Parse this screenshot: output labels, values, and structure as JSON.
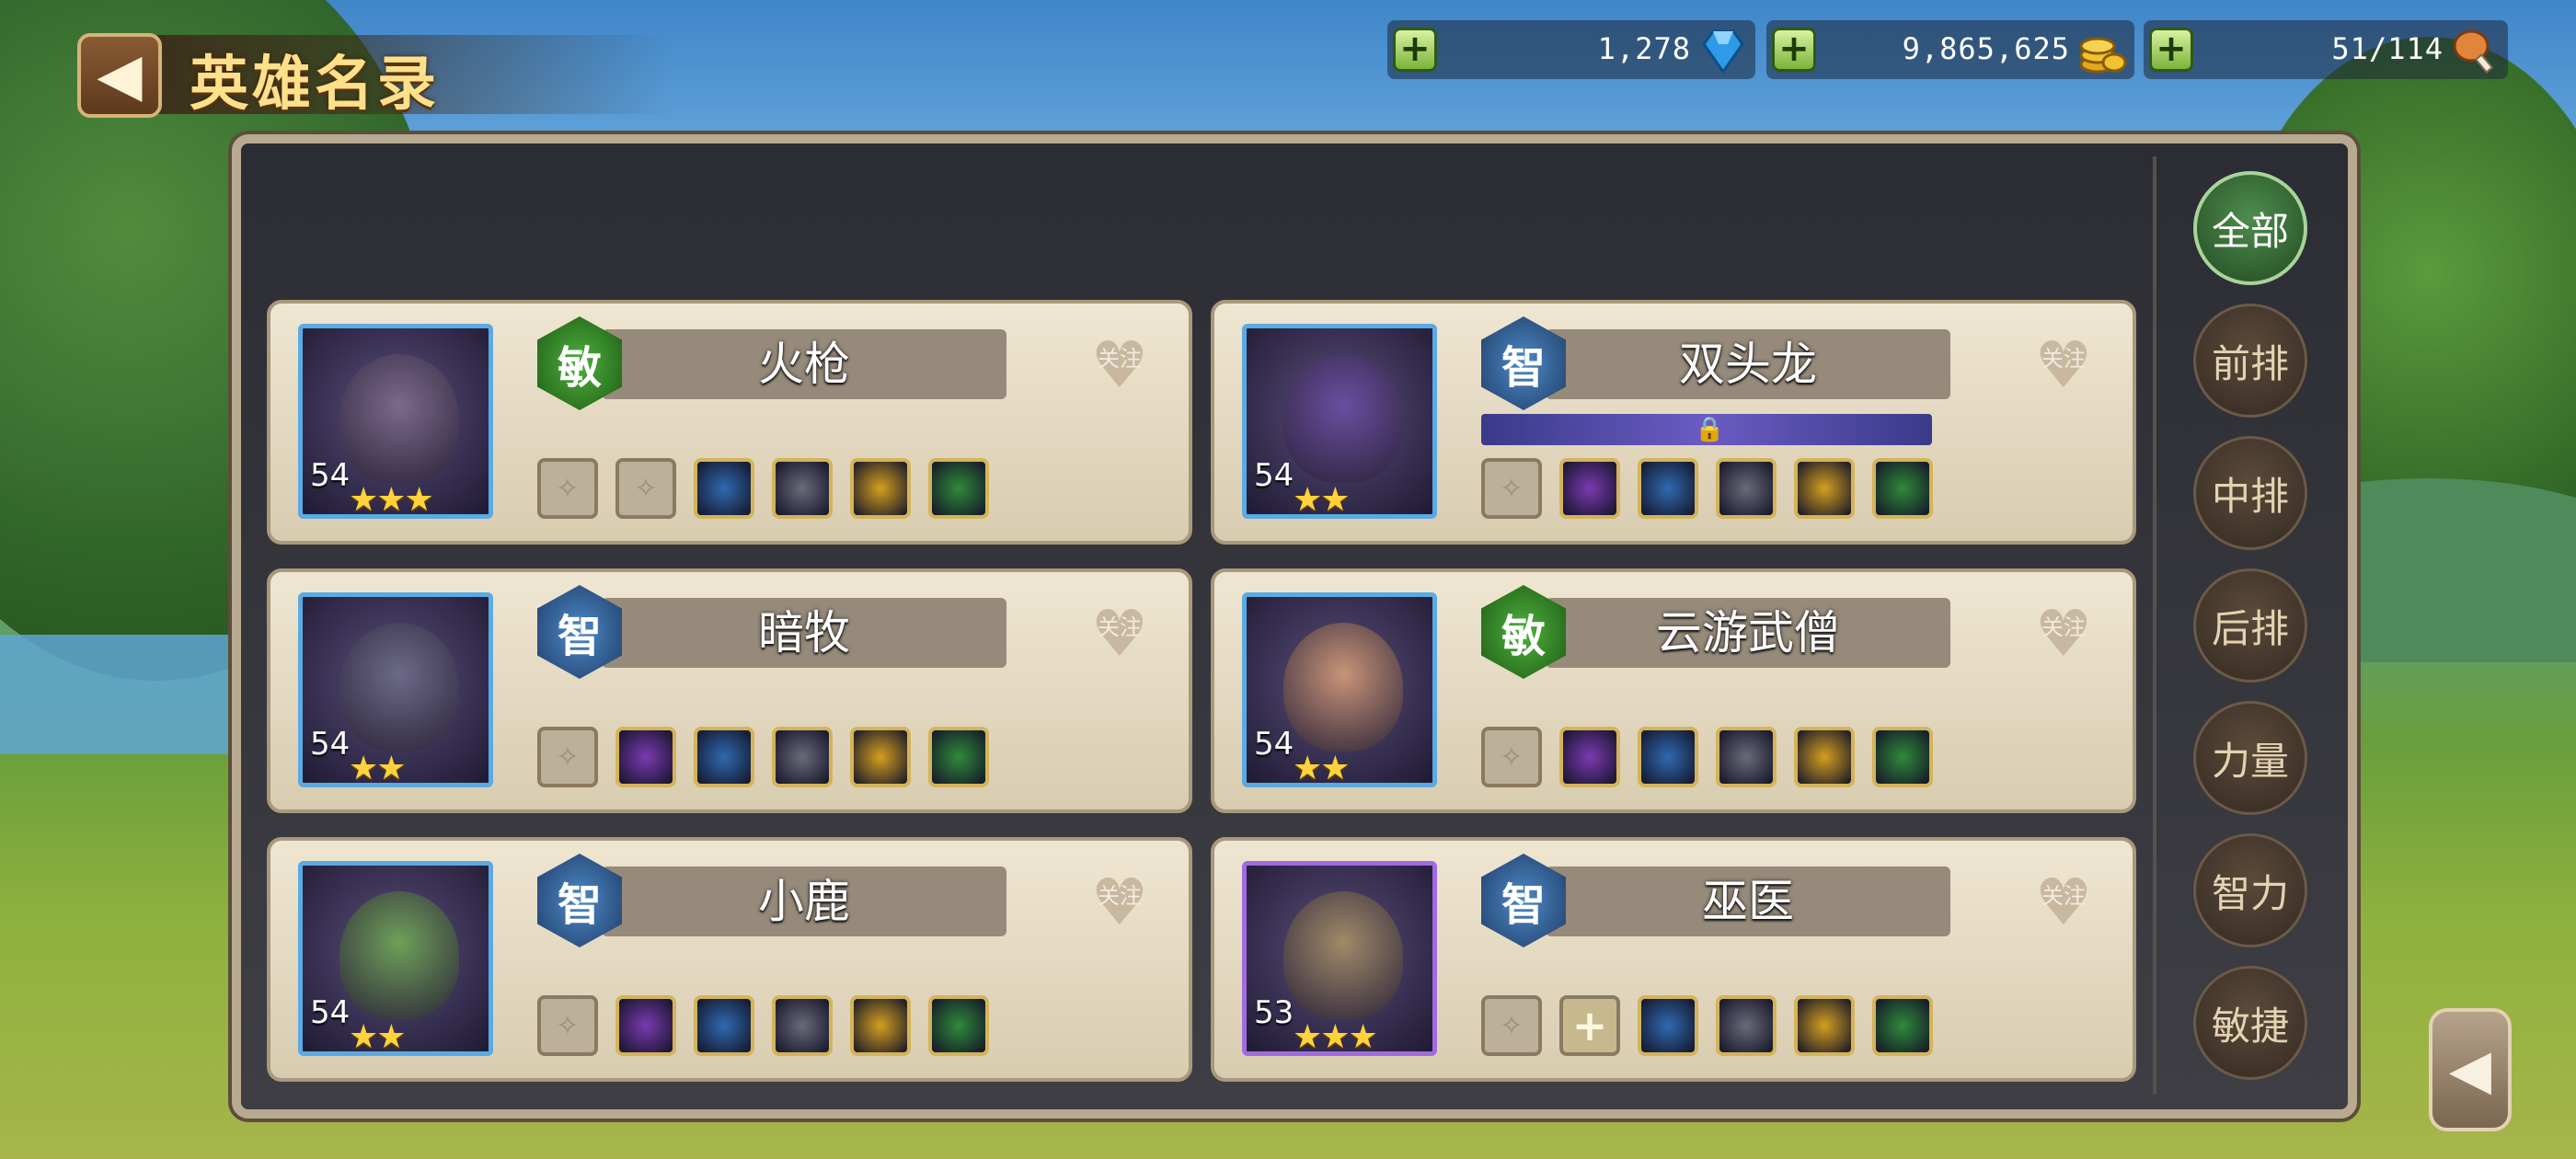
{
  "header": {
    "title": "英雄名录",
    "back_icon": "back-arrow-icon"
  },
  "resources": [
    {
      "name": "diamond",
      "value": "1,278",
      "icon": "diamond-icon",
      "color": "#3fa9f5"
    },
    {
      "name": "gold",
      "value": "9,865,625",
      "icon": "gold-coins-icon",
      "color": "#f2c230"
    },
    {
      "name": "stamina",
      "value": "51/114",
      "icon": "meat-drumstick-icon",
      "color": "#e0853a"
    }
  ],
  "filters": [
    {
      "label": "全部",
      "active": true
    },
    {
      "label": "前排",
      "active": false
    },
    {
      "label": "中排",
      "active": false
    },
    {
      "label": "后排",
      "active": false
    },
    {
      "label": "力量",
      "active": false
    },
    {
      "label": "智力",
      "active": false
    },
    {
      "label": "敏捷",
      "active": false
    }
  ],
  "follow_label": "关注",
  "heroes": [
    {
      "name": "火枪",
      "attr": "敏",
      "level": "54",
      "stars": 3,
      "items": [
        "empty",
        "empty",
        "hammer-icon",
        "mask-icon",
        "sword-icon",
        "boot-icon"
      ]
    },
    {
      "name": "双头龙",
      "attr": "智",
      "level": "54",
      "stars": 2,
      "locked_bar": true,
      "items": [
        "empty",
        "orb-icon",
        "skull-icon",
        "helm-icon",
        "potion-icon",
        "boot-icon"
      ]
    },
    {
      "name": "暗牧",
      "attr": "智",
      "level": "54",
      "stars": 2,
      "items": [
        "empty",
        "book-icon",
        "staff-icon",
        "cloak-icon",
        "ring-icon",
        "boot-icon"
      ]
    },
    {
      "name": "云游武僧",
      "attr": "敏",
      "level": "54",
      "stars": 2,
      "items": [
        "empty",
        "blade-icon",
        "gauntlet-icon",
        "mask-icon",
        "armor-icon",
        "boot-icon"
      ]
    },
    {
      "name": "小鹿",
      "attr": "智",
      "level": "54",
      "stars": 2,
      "items": [
        "empty",
        "gem-icon",
        "staff-icon",
        "sword-icon",
        "cloak-icon",
        "boot-icon"
      ]
    },
    {
      "name": "巫医",
      "attr": "智",
      "level": "53",
      "stars": 3,
      "items": [
        "empty",
        "add",
        "dagger-icon",
        "orb-icon",
        "sword-icon",
        "axe-icon"
      ]
    }
  ]
}
